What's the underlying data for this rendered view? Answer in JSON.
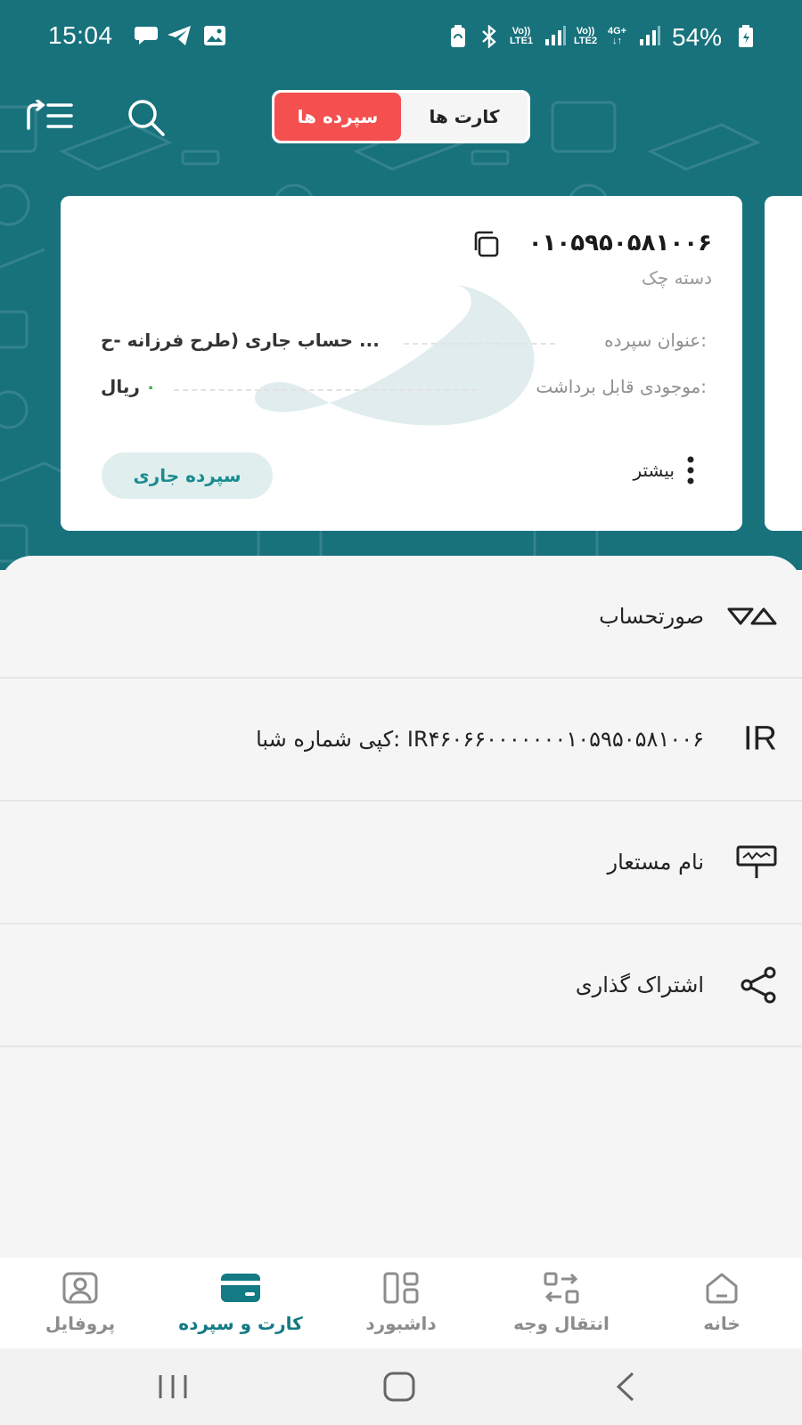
{
  "status_bar": {
    "time": "15:04",
    "battery": "54%",
    "sim1": {
      "top": "Vo))",
      "bottom": "LTE1"
    },
    "sim2": {
      "top": "Vo))",
      "bottom": "LTE2"
    },
    "network": "4G+",
    "icons": [
      "chat-bubble-icon",
      "telegram-icon",
      "gallery-icon",
      "battery-saver-icon",
      "bluetooth-icon",
      "signal-icon",
      "battery-icon"
    ]
  },
  "toolbar": {
    "tabs": [
      {
        "label": "کارت ها",
        "active": false
      },
      {
        "label": "سپرده ها",
        "active": true
      }
    ],
    "icons": [
      "menu-export-icon",
      "search-icon"
    ]
  },
  "account_card": {
    "number": "۰۱۰۵۹۵۰۵۸۱۰۰۶",
    "type": "دسته چک",
    "title_label": "عنوان سپرده:",
    "title_value": "حساب جاری (طرح فرزانه -ح ...",
    "balance_label": "موجودی قابل برداشت:",
    "balance_value": "۰",
    "currency": "ریال",
    "deposit_type": "سپرده جاری",
    "more_label": "بیشتر"
  },
  "menu": [
    {
      "label": "صورتحساب",
      "icon": "statement-icon"
    },
    {
      "label": "کپی شماره شبا: IR۴۶۰۶۶۰۰۰۰۰۰۰۱۰۵۹۵۰۵۸۱۰۰۶",
      "icon_text": "IR"
    },
    {
      "label": "نام مستعار",
      "icon": "nickname-sign-icon"
    },
    {
      "label": "اشتراک گذاری",
      "icon": "share-icon"
    }
  ],
  "bottom_nav": [
    {
      "label": "پروفایل",
      "icon": "profile-icon",
      "active": false
    },
    {
      "label": "کارت و سپرده",
      "icon": "card-icon",
      "active": true
    },
    {
      "label": "داشبورد",
      "icon": "dashboard-icon",
      "active": false
    },
    {
      "label": "انتقال وجه",
      "icon": "transfer-icon",
      "active": false
    },
    {
      "label": "خانه",
      "icon": "home-icon",
      "active": false
    }
  ],
  "colors": {
    "header": "#17727c",
    "active_tab": "#f3504f",
    "accent": "#147a83",
    "pill_bg": "#e0eeee"
  }
}
